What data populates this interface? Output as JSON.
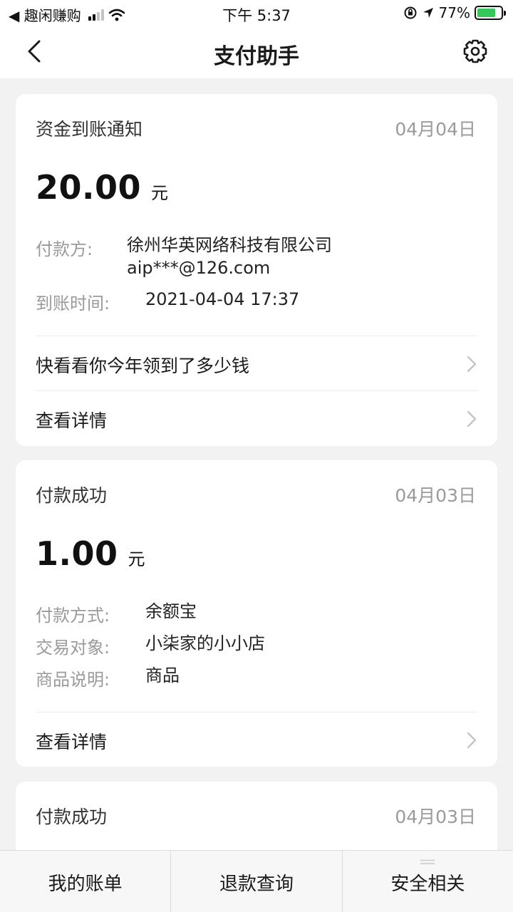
{
  "status_bar": {
    "back_app": "◀ 趣闲赚购",
    "time": "下午 5:37",
    "battery_pct": "77%",
    "battery_level": 0.77,
    "battery_color": "#35c759"
  },
  "navbar": {
    "title": "支付助手",
    "back_icon": "chevron-left-icon",
    "settings_icon": "gear-icon"
  },
  "cards": [
    {
      "title": "资金到账通知",
      "date": "04月04日",
      "amount": "20.00",
      "unit": "元",
      "fields": [
        {
          "label": "付款方:",
          "value_line1": "徐州华英网络科技有限公司",
          "value_line2": "aip***@126.com"
        },
        {
          "label": "到账时间:",
          "value": "2021-04-04 17:37"
        }
      ],
      "links": [
        "快看看你今年领到了多少钱",
        "查看详情"
      ]
    },
    {
      "title": "付款成功",
      "date": "04月03日",
      "amount": "1.00",
      "unit": "元",
      "fields": [
        {
          "label": "付款方式:",
          "value": "余额宝"
        },
        {
          "label": "交易对象:",
          "value": "小柒家的小小店"
        },
        {
          "label": "商品说明:",
          "value": "商品"
        }
      ],
      "links": [
        "查看详情"
      ]
    },
    {
      "title": "付款成功",
      "date": "04月03日"
    }
  ],
  "tabbar": {
    "tabs": [
      "我的账单",
      "退款查询",
      "安全相关"
    ]
  }
}
